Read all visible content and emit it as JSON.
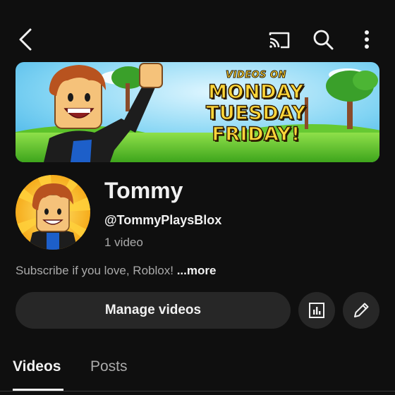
{
  "topbar": {
    "back_icon": "chevron-left-icon",
    "cast_icon": "cast-icon",
    "search_icon": "search-icon",
    "more_icon": "vertical-dots-icon"
  },
  "banner": {
    "line1": "VIDEOS ON",
    "line2": "MONDAY",
    "line3": "TUESDAY",
    "line4": "FRIDAY!"
  },
  "channel": {
    "name": "Tommy",
    "handle": "@TommyPlaysBlox",
    "video_count": "1 video",
    "description": "Subscribe if you love, Roblox!",
    "more_label": "...more"
  },
  "actions": {
    "manage_label": "Manage videos",
    "stats_icon": "analytics-icon",
    "edit_icon": "pencil-icon"
  },
  "tabs": [
    {
      "label": "Videos",
      "active": true
    },
    {
      "label": "Posts",
      "active": false
    }
  ],
  "colors": {
    "background": "#0f0f0f",
    "button_bg": "#272727",
    "text_primary": "#f1f1f1",
    "text_secondary": "#aaaaaa",
    "banner_text": "#ffd63a"
  }
}
